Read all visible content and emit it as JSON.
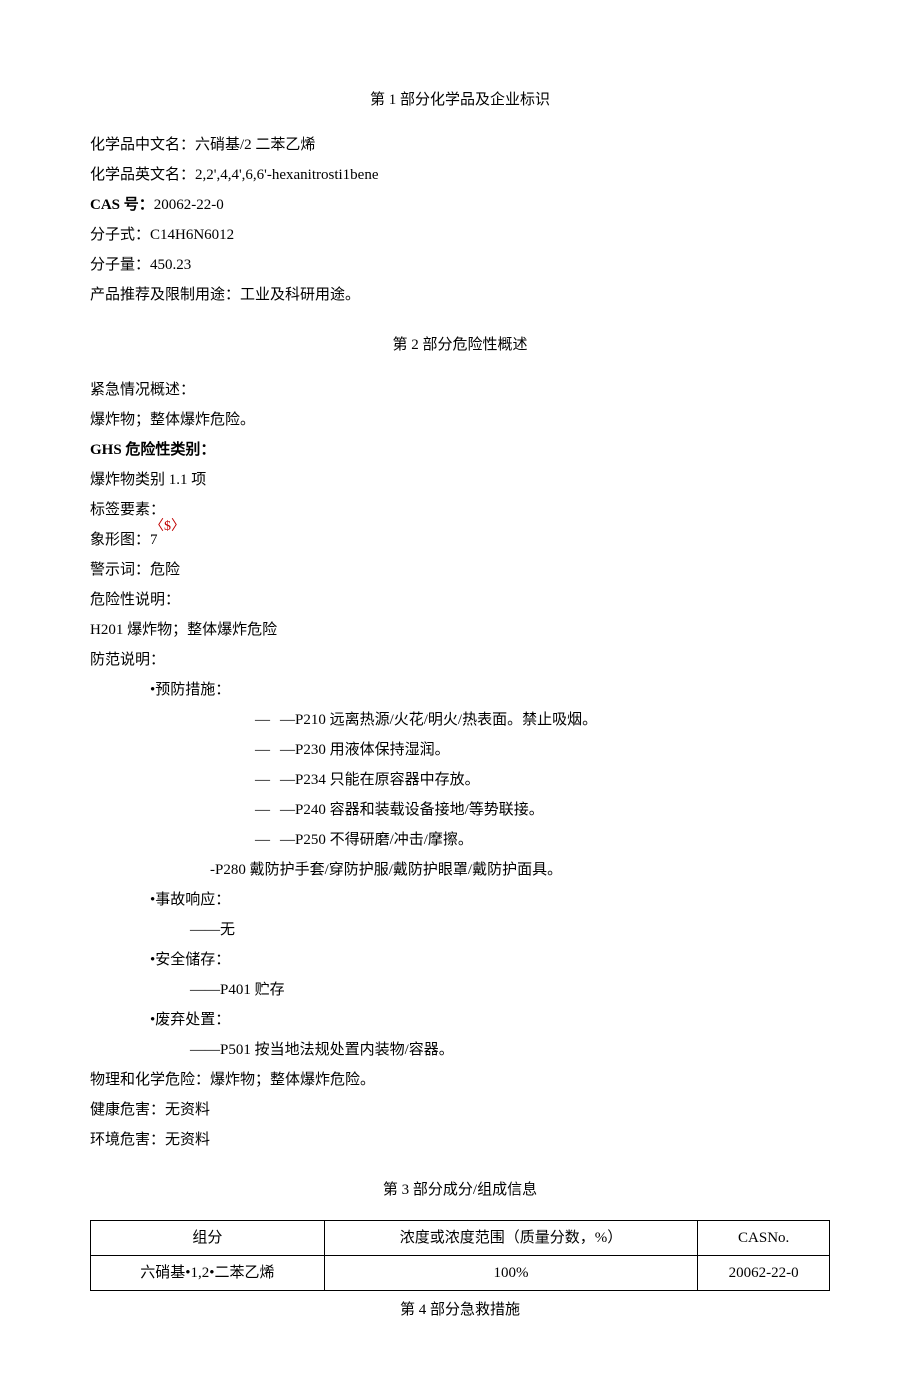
{
  "section1": {
    "title": "第 1 部分化学品及企业标识",
    "cn_name_label": "化学品中文名：",
    "cn_name": "六硝基/2 二苯乙烯",
    "en_name_label": "化学品英文名：",
    "en_name": "2,2',4,4',6,6'-hexanitrosti1bene",
    "cas_label": "CAS 号：",
    "cas": "20062-22-0",
    "formula_label": "分子式：",
    "formula": "C14H6N6012",
    "mw_label": "分子量：",
    "mw": "450.23",
    "use_label": "产品推荐及限制用途：",
    "use": "工业及科研用途。"
  },
  "section2": {
    "title": "第 2 部分危险性概述",
    "emergency_label": "紧急情况概述：",
    "emergency": "爆炸物；整体爆炸危险。",
    "ghs_label": "GHS 危险性类别：",
    "ghs": "爆炸物类别 1.1 项",
    "labelelem": "标签要素：",
    "pictogram_sup": "〈$〉",
    "pictogram_label": "象形图：",
    "pictogram_val": "7",
    "signal_label": "警示词：",
    "signal": "危险",
    "hazard_label": "危险性说明：",
    "hazard": "H201 爆炸物；整体爆炸危险",
    "precaution_label": "防范说明：",
    "prevention_title": "•预防措施：",
    "p210": "—P210 远离热源/火花/明火/热表面。禁止吸烟。",
    "p230": "—P230 用液体保持湿润。",
    "p234": "—P234 只能在原容器中存放。",
    "p240": "—P240 容器和装载设备接地/等势联接。",
    "p250": "—P250 不得研磨/冲击/摩擦。",
    "p280": "-P280 戴防护手套/穿防护服/戴防护眼罩/戴防护面具。",
    "response_title": "•事故响应：",
    "response_none": "——无",
    "storage_title": "•安全储存：",
    "storage_p401": "——P401 贮存",
    "disposal_title": "•废弃处置：",
    "disposal_p501": "——P501 按当地法规处置内装物/容器。",
    "physchem_label": "物理和化学危险：",
    "physchem": "爆炸物；整体爆炸危险。",
    "health_label": "健康危害：",
    "health": "无资料",
    "env_label": "环境危害：",
    "env": "无资料"
  },
  "section3": {
    "title": "第 3 部分成分/组成信息",
    "headers": {
      "comp": "组分",
      "conc": "浓度或浓度范围（质量分数，%）",
      "cas": "CASNo."
    },
    "row": {
      "comp": "六硝基•1,2•二苯乙烯",
      "conc": "100%",
      "cas": "20062-22-0"
    }
  },
  "section4": {
    "title": "第 4 部分急救措施"
  },
  "dash": "—"
}
